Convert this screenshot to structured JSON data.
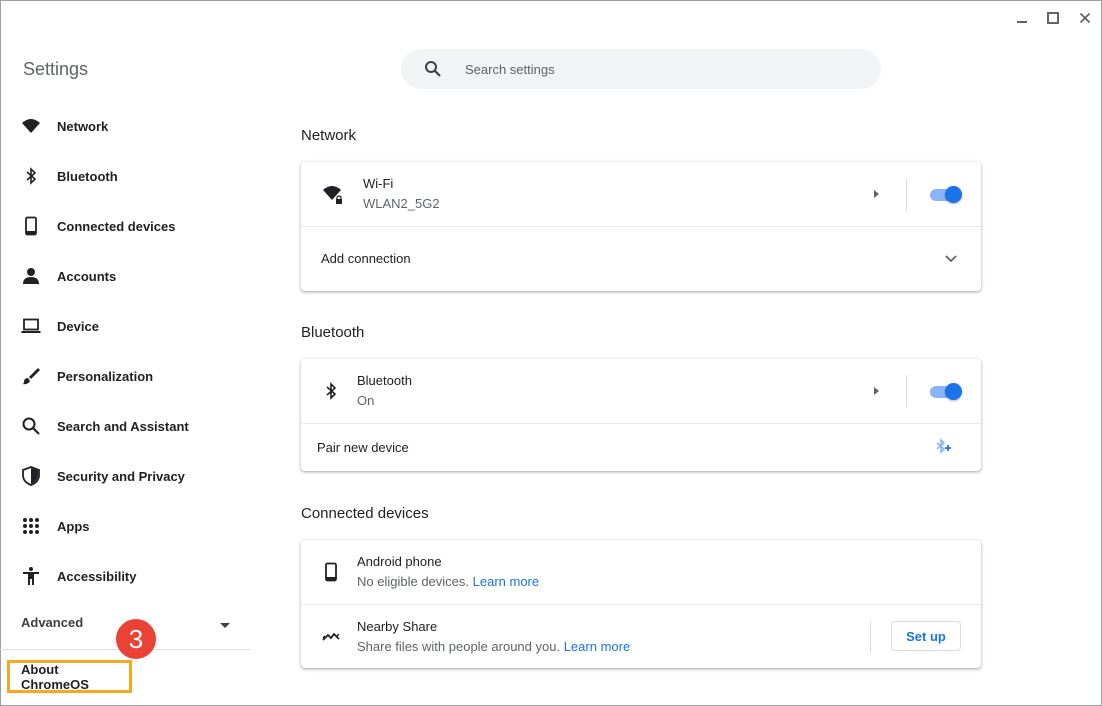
{
  "window": {
    "minimize_icon": "minimize-icon",
    "maximize_icon": "maximize-icon",
    "close_icon": "close-icon"
  },
  "sidebar": {
    "title": "Settings",
    "items": [
      {
        "label": "Network",
        "icon": "wifi-icon"
      },
      {
        "label": "Bluetooth",
        "icon": "bluetooth-icon"
      },
      {
        "label": "Connected devices",
        "icon": "phone-icon"
      },
      {
        "label": "Accounts",
        "icon": "person-icon"
      },
      {
        "label": "Device",
        "icon": "laptop-icon"
      },
      {
        "label": "Personalization",
        "icon": "brush-icon"
      },
      {
        "label": "Search and Assistant",
        "icon": "search-icon"
      },
      {
        "label": "Security and Privacy",
        "icon": "shield-icon"
      },
      {
        "label": "Apps",
        "icon": "apps-grid-icon"
      },
      {
        "label": "Accessibility",
        "icon": "accessibility-icon"
      }
    ],
    "advanced_label": "Advanced",
    "about_label": "About ChromeOS",
    "step_badge": "3"
  },
  "search": {
    "placeholder": "Search settings"
  },
  "network": {
    "heading": "Network",
    "wifi_title": "Wi-Fi",
    "wifi_network": "WLAN2_5G2",
    "wifi_enabled": true,
    "add_connection_label": "Add connection"
  },
  "bluetooth": {
    "heading": "Bluetooth",
    "title": "Bluetooth",
    "status": "On",
    "enabled": true,
    "pair_label": "Pair new device"
  },
  "connected_devices": {
    "heading": "Connected devices",
    "android_title": "Android phone",
    "android_desc": "No eligible devices.",
    "android_link": "Learn more",
    "nearby_title": "Nearby Share",
    "nearby_desc": "Share files with people around you.",
    "nearby_link": "Learn more",
    "setup_label": "Set up"
  },
  "colors": {
    "accent": "#1a73e8",
    "toggle_track": "#8ab4f8",
    "highlight_box": "#f6a821",
    "step_badge": "#ea4335"
  }
}
